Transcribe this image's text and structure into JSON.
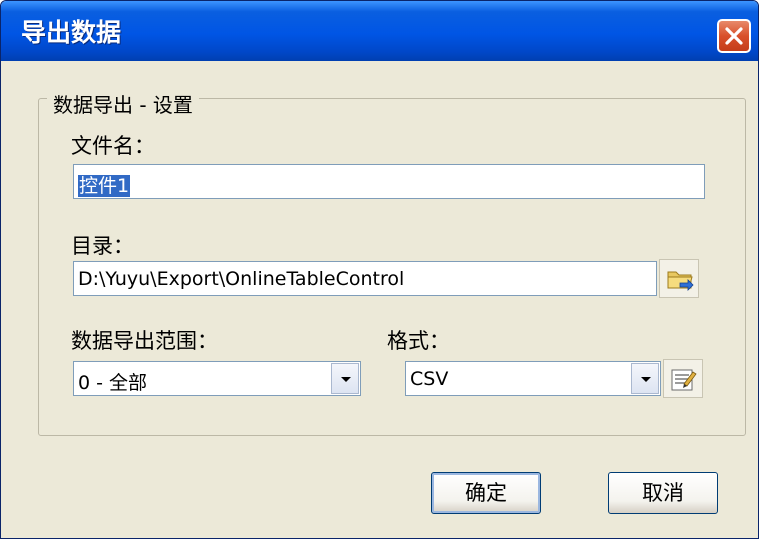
{
  "window": {
    "title": "导出数据"
  },
  "group": {
    "legend": "数据导出 - 设置",
    "filename_label": "文件名：",
    "filename_value": "控件1",
    "dir_label": "目录：",
    "dir_value": "D:\\Yuyu\\Export\\OnlineTableControl",
    "range_label": "数据导出范围：",
    "range_value": "0 - 全部",
    "format_label": "格式：",
    "format_value": "CSV"
  },
  "buttons": {
    "ok": "确定",
    "cancel": "取消"
  },
  "icons": {
    "close": "close-icon",
    "browse": "folder-browse-icon",
    "format_settings": "format-settings-icon",
    "dropdown": "chevron-down-icon"
  },
  "colors": {
    "title_bar": "#0055e5",
    "dialog_background": "#ece9d8",
    "close_button": "#d9502b",
    "selection": "#316ac5"
  }
}
